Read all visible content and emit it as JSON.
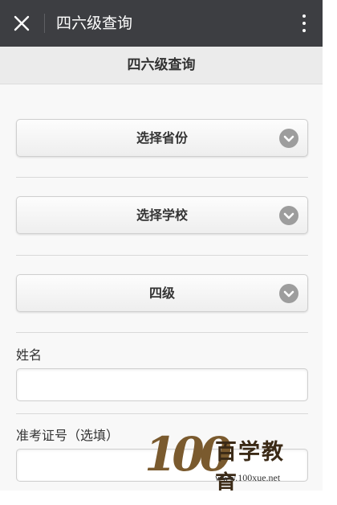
{
  "nav": {
    "close_icon": "close-icon",
    "title": "四六级查询",
    "more_icon": "more-vertical-icon"
  },
  "header": {
    "title": "四六级查询"
  },
  "selects": {
    "province": "选择省份",
    "school": "选择学校",
    "level": "四级",
    "arrow_icon": "chevron-down-icon"
  },
  "fields": {
    "name_label": "姓名",
    "name_value": "",
    "ticket_label": "准考证号（选填）",
    "ticket_value": ""
  },
  "watermark": {
    "logo_digits": "100",
    "brand": "百学教育",
    "url": "www.100xue.net"
  },
  "colors": {
    "nav_bg": "#3d3e42",
    "header_bg": "#ebebeb",
    "arrow_bg": "#9d9d9d"
  }
}
